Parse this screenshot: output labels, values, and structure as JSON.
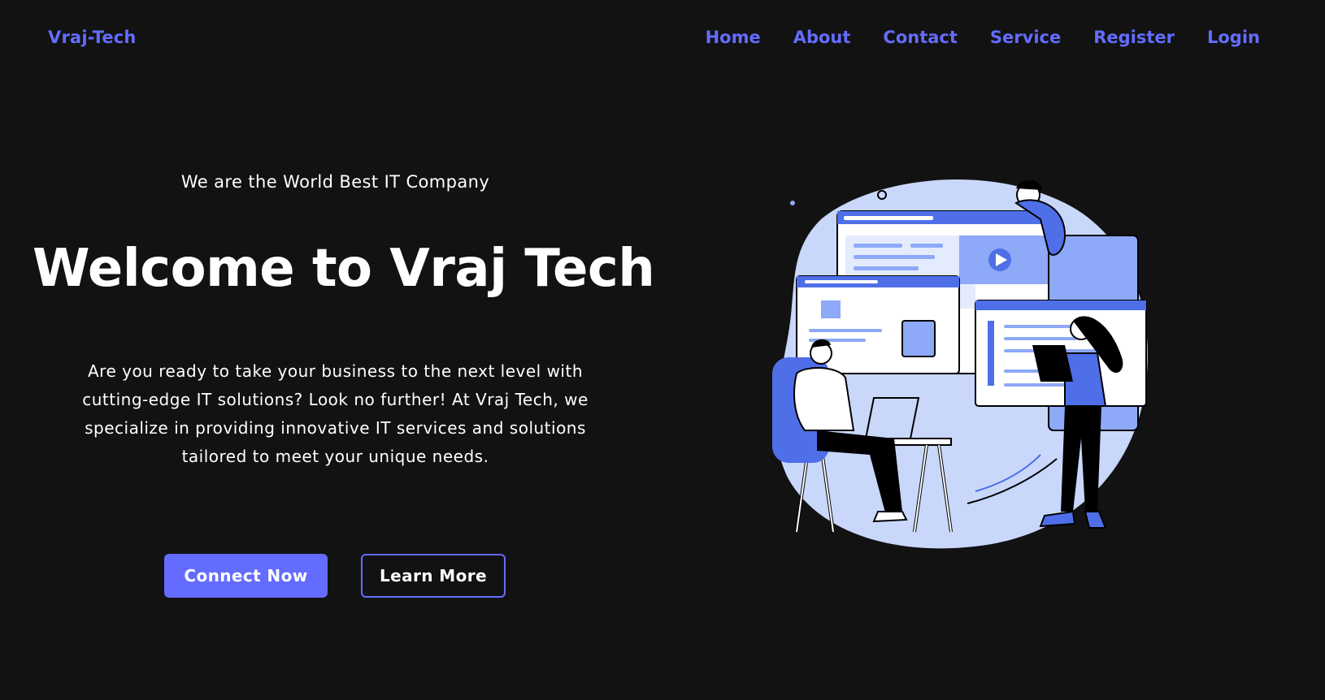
{
  "navbar": {
    "logo": "Vraj-Tech",
    "links": [
      "Home",
      "About",
      "Contact",
      "Service",
      "Register",
      "Login"
    ]
  },
  "hero": {
    "tagline": "We are the World Best IT Company",
    "headline": "Welcome to Vraj Tech",
    "description": "Are you ready to take your business to the next level with cutting-edge IT solutions? Look no further! At Vraj Tech, we specialize in providing innovative IT services and solutions tailored to meet your unique needs.",
    "primary_button": "Connect Now",
    "secondary_button": "Learn More"
  },
  "colors": {
    "accent": "#646cff",
    "background": "#121212",
    "illustration_light": "#c9d7fb",
    "illustration_mid": "#8da9f7",
    "illustration_dark": "#4f6fe8"
  }
}
